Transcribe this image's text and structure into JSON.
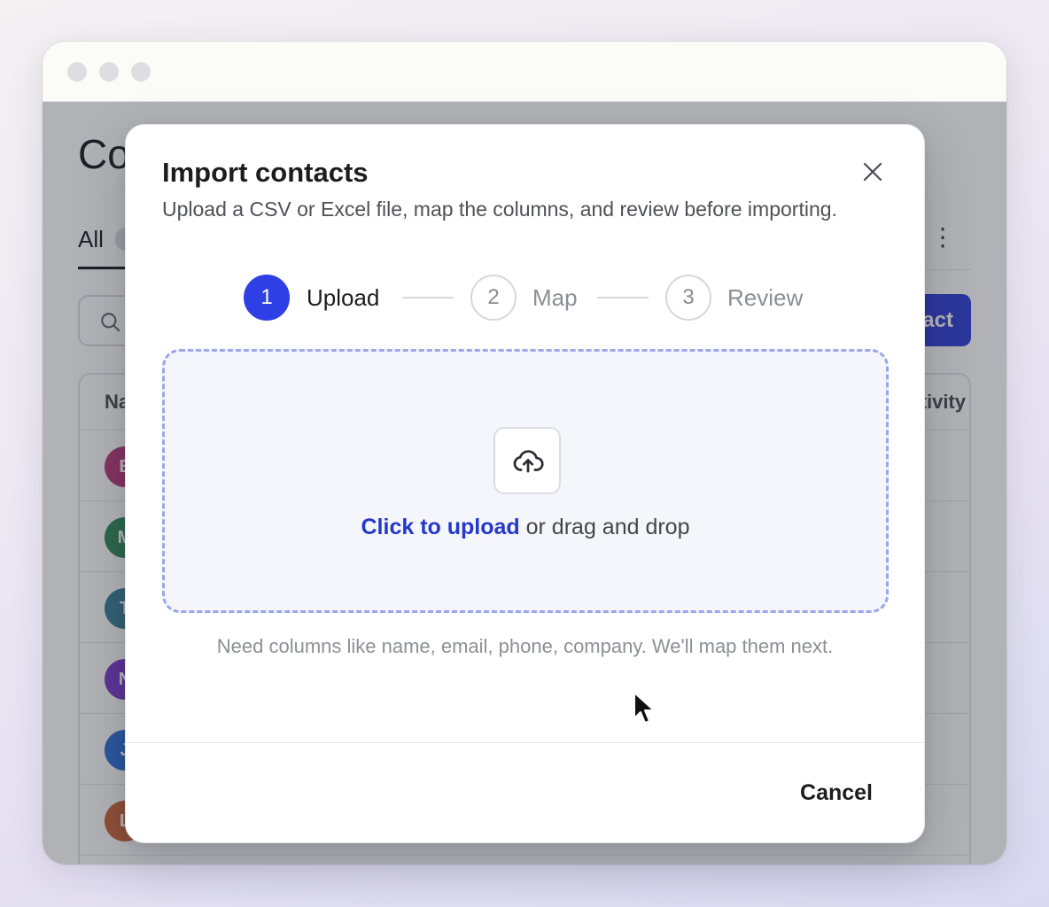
{
  "background_app": {
    "page_title": "Contacts",
    "tab_all_label": "All",
    "search_placeholder": "Search",
    "add_button_label": "Add contact",
    "column_name": "Name",
    "column_activity": "Last activity",
    "rows": [
      {
        "initial": "E",
        "color": "#b73a7c"
      },
      {
        "initial": "M",
        "color": "#2f8a5a"
      },
      {
        "initial": "T",
        "color": "#3a7f98"
      },
      {
        "initial": "N",
        "color": "#7a3ccb"
      },
      {
        "initial": "J",
        "color": "#2e6fd8"
      },
      {
        "initial": "L",
        "color": "#c8643a"
      }
    ]
  },
  "modal": {
    "title": "Import contacts",
    "subtitle": "Upload a CSV or Excel file, map the columns, and review before importing.",
    "steps": [
      {
        "number": "1",
        "label": "Upload",
        "state": "active"
      },
      {
        "number": "2",
        "label": "Map",
        "state": "todo"
      },
      {
        "number": "3",
        "label": "Review",
        "state": "todo"
      }
    ],
    "dropzone": {
      "link_text": "Click to upload",
      "rest_text": " or drag and drop",
      "icon": "cloud-upload-icon"
    },
    "hint": "Need columns like name, email, phone, company. We'll map them next.",
    "cancel_label": "Cancel",
    "close_icon": "close-icon"
  },
  "colors": {
    "accent": "#2f3fe6",
    "link": "#2438c9",
    "dropzone_border": "#9aa7e8"
  }
}
